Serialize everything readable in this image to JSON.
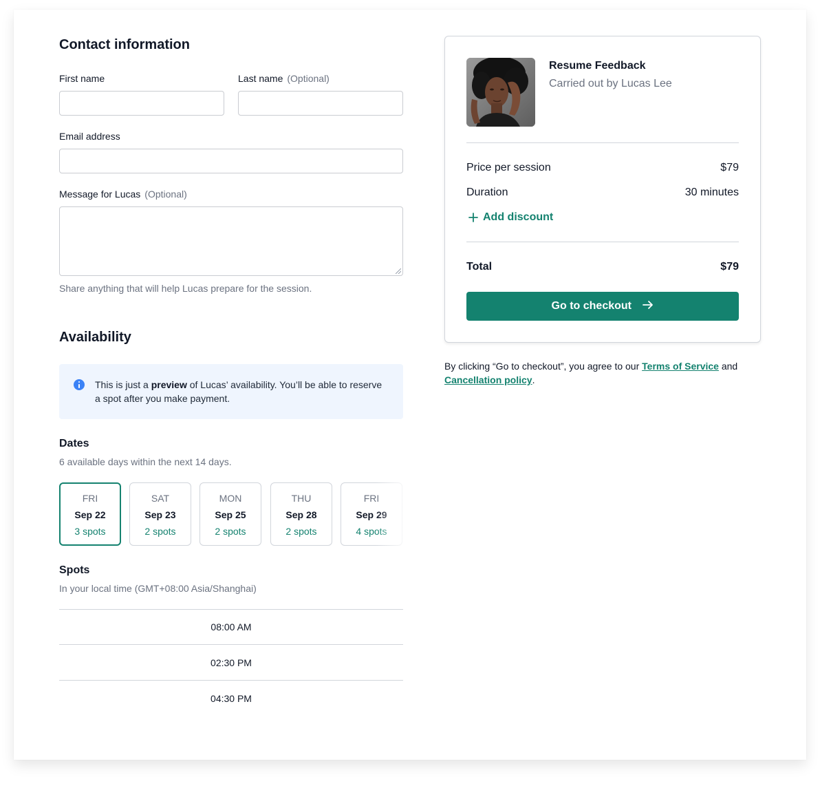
{
  "contact": {
    "title": "Contact information",
    "first_name_label": "First name",
    "last_name_label": "Last name",
    "optional": "(Optional)",
    "email_label": "Email address",
    "message_label": "Message for Lucas",
    "message_help": "Share anything that will help Lucas prepare for the session."
  },
  "availability": {
    "title": "Availability",
    "info_prefix": "This is just a ",
    "info_bold": "preview",
    "info_suffix": " of Lucas’ availability. You’ll be able to reserve a spot after you make payment.",
    "dates_title": "Dates",
    "dates_sub": "6 available days within the next 14 days.",
    "dates": [
      {
        "dow": "FRI",
        "date": "Sep 22",
        "spots": "3 spots"
      },
      {
        "dow": "SAT",
        "date": "Sep 23",
        "spots": "2 spots"
      },
      {
        "dow": "MON",
        "date": "Sep 25",
        "spots": "2 spots"
      },
      {
        "dow": "THU",
        "date": "Sep 28",
        "spots": "2 spots"
      },
      {
        "dow": "FRI",
        "date": "Sep 29",
        "spots": "4 spots"
      }
    ],
    "spots_title": "Spots",
    "spots_sub": "In your local time (GMT+08:00 Asia/Shanghai)",
    "slots": [
      "08:00 AM",
      "02:30 PM",
      "04:30 PM"
    ]
  },
  "summary": {
    "service_title": "Resume Feedback",
    "provider": "Carried out by Lucas Lee",
    "price_label": "Price per session",
    "price_value": "$79",
    "duration_label": "Duration",
    "duration_value": "30 minutes",
    "add_discount": "Add discount",
    "total_label": "Total",
    "total_value": "$79",
    "checkout_label": "Go to checkout"
  },
  "terms": {
    "prefix": "By clicking “Go to checkout”, you agree to our ",
    "tos": "Terms of Service",
    "and": " and",
    "cancellation": "Cancellation policy",
    "end": "."
  },
  "colors": {
    "accent": "#14826f",
    "info_bg": "#eff5fe",
    "info_icon": "#3b82f6"
  }
}
